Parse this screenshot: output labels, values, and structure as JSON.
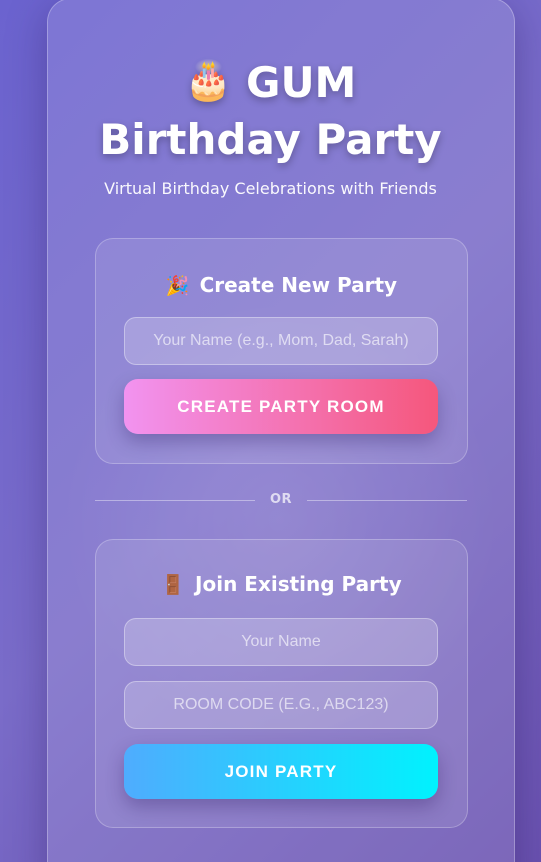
{
  "header": {
    "cake_emoji": "🎂",
    "title_line1": "GUM",
    "title_line2": "Birthday Party",
    "subtitle": "Virtual Birthday Celebrations with Friends"
  },
  "create_party": {
    "emoji": "🎉",
    "title": "Create New Party",
    "name_placeholder": "Your Name (e.g., Mom, Dad, Sarah)",
    "button_label": "CREATE PARTY ROOM"
  },
  "divider": {
    "label": "OR"
  },
  "join_party": {
    "emoji": "🚪",
    "title": "Join Existing Party",
    "name_placeholder": "Your Name",
    "room_code_placeholder": "Room Code (e.g., ABC123)",
    "button_label": "JOIN PARTY"
  },
  "colors": {
    "create_button_gradient": [
      "#f293f0",
      "#f5577c"
    ],
    "join_button_gradient": [
      "#4facfe",
      "#00f2fe"
    ],
    "background": "#6b63cf"
  }
}
